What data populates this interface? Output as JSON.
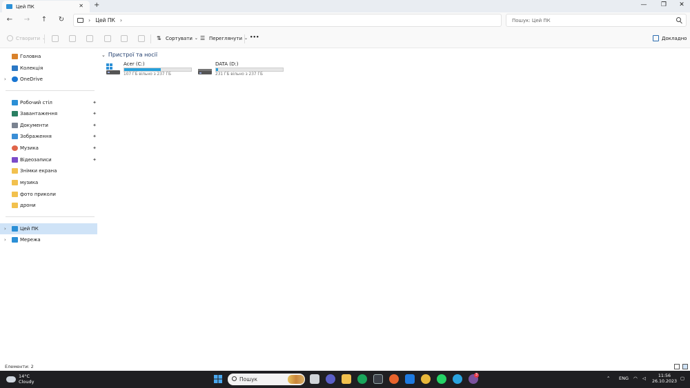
{
  "window": {
    "tab_title": "Цей ПК",
    "tab_close": "✕",
    "tab_add": "+",
    "minimize": "—",
    "maximize": "❐",
    "close": "✕"
  },
  "nav": {
    "back": "←",
    "forward": "→",
    "up": "↑",
    "refresh": "↻"
  },
  "address": {
    "crumb": "Цей ПК",
    "separator": "›"
  },
  "search": {
    "placeholder": "Пошук: Цей ПК"
  },
  "toolbar": {
    "create_label": "Створити",
    "sort_label": "Сортувати",
    "view_label": "Переглянути",
    "more_label": "•••",
    "details_label": "Докладно"
  },
  "sidebar": {
    "items": [
      {
        "label": "Головна",
        "icon": "home-icon",
        "color": "#d9822b"
      },
      {
        "label": "Колекція",
        "icon": "gallery-icon",
        "color": "#2b78c5"
      },
      {
        "label": "OneDrive",
        "icon": "onedrive-icon",
        "color": "#1976d2"
      },
      {
        "label": "Робочий стіл",
        "icon": "desktop-icon",
        "color": "#2b8fd6"
      },
      {
        "label": "Завантаження",
        "icon": "download-icon",
        "color": "#2a7f62"
      },
      {
        "label": "Документи",
        "icon": "documents-icon",
        "color": "#7a8390"
      },
      {
        "label": "Зображення",
        "icon": "pictures-icon",
        "color": "#3a8ed6"
      },
      {
        "label": "Музика",
        "icon": "music-icon",
        "color": "#e0654a"
      },
      {
        "label": "Відеозаписи",
        "icon": "videos-icon",
        "color": "#7b4bc9"
      },
      {
        "label": "Знімки екрана",
        "icon": "folder-icon",
        "color": "#f2c14e"
      },
      {
        "label": "музика",
        "icon": "folder-icon",
        "color": "#f2c14e"
      },
      {
        "label": "фото приколи",
        "icon": "folder-icon",
        "color": "#f2c14e"
      },
      {
        "label": "дрони",
        "icon": "folder-icon",
        "color": "#f2c14e"
      },
      {
        "label": "Цей ПК",
        "icon": "this-pc-icon",
        "color": "#2b8fd6"
      },
      {
        "label": "Мережа",
        "icon": "network-icon",
        "color": "#2b8fd6"
      }
    ],
    "pin_glyph": "📌",
    "chevron": "›"
  },
  "main": {
    "group_title": "Пристрої та носії",
    "group_chevron": "⌄",
    "drives": [
      {
        "name": "Acer (C:)",
        "free_text": "107 ГБ вільно з 237 ГБ",
        "used_fraction": 0.55,
        "icon": "windows-drive-icon"
      },
      {
        "name": "DATA (D:)",
        "free_text": "231 ГБ вільно з 237 ГБ",
        "used_fraction": 0.03,
        "icon": "drive-icon"
      }
    ]
  },
  "status": {
    "count": "Елементи: 2"
  },
  "taskbar": {
    "temp": "14°C",
    "weather": "Cloudy",
    "search_label": "Пошук",
    "lang": "ENG",
    "time": "11:56",
    "date": "26.10.2023",
    "viber_badge": "3"
  }
}
